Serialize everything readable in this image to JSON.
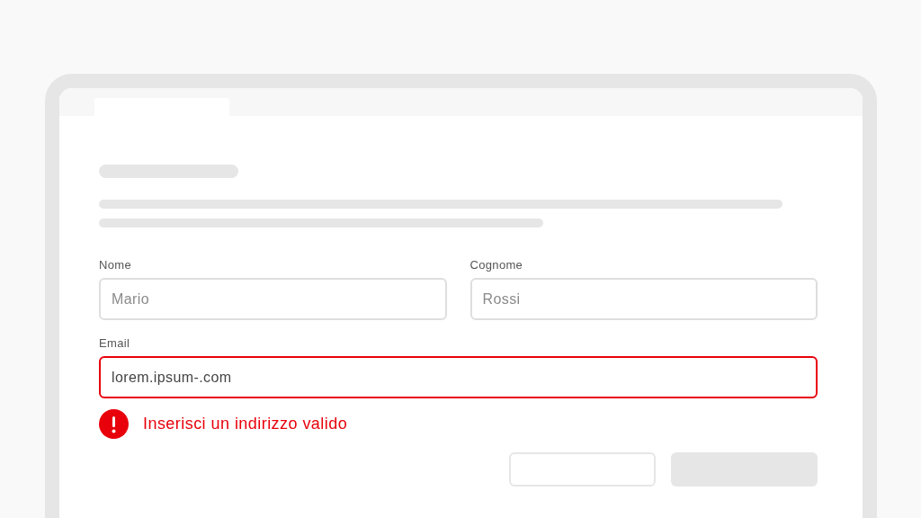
{
  "fields": [
    {
      "label": "Nome",
      "placeholder": "Mario",
      "invalid": false
    },
    {
      "label": "Cognome",
      "placeholder": "Rossi",
      "invalid": false
    },
    {
      "label": "Email",
      "value": "lorem.ipsum-.com",
      "invalid": true
    }
  ],
  "error": {
    "message": "Inserisci un indirizzo valido"
  },
  "actions": [
    {
      "kind": "outline"
    },
    {
      "kind": "filled"
    }
  ]
}
